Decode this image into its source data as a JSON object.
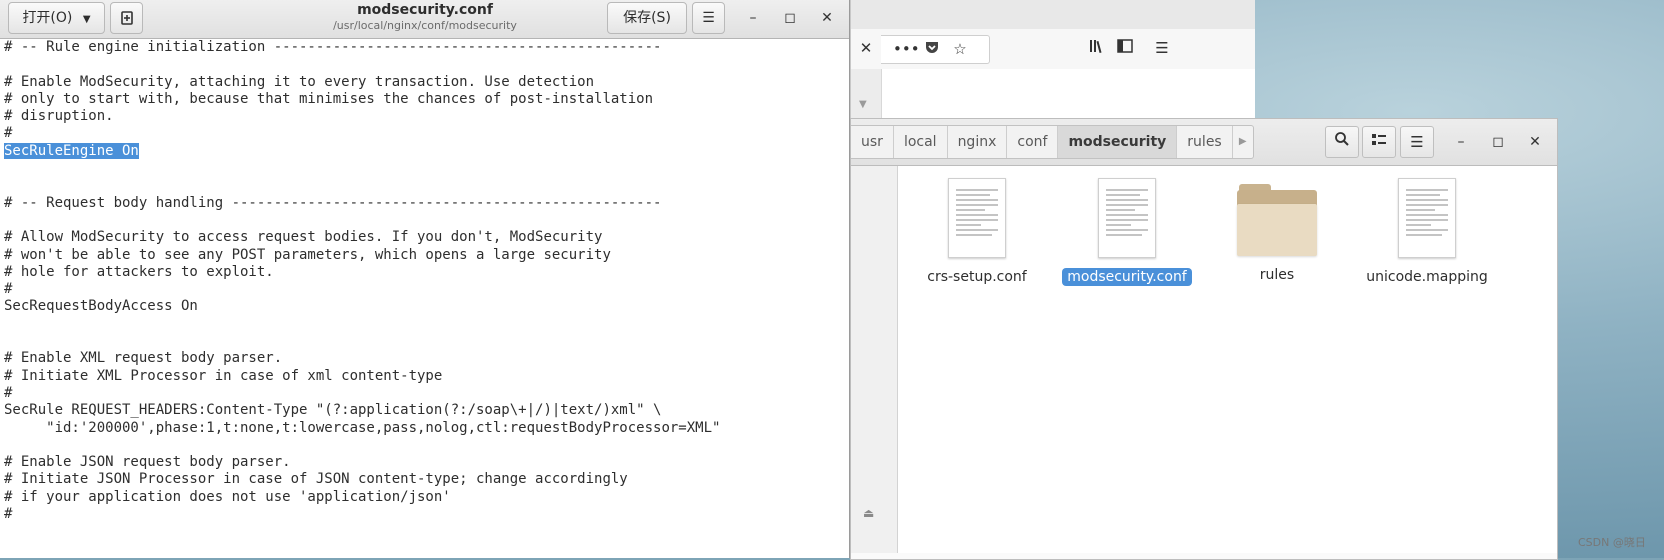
{
  "gedit": {
    "open_label": "打开(O)",
    "save_label": "保存(S)",
    "title": "modsecurity.conf",
    "subtitle": "/usr/local/nginx/conf/modsecurity",
    "lines": [
      "# -- Rule engine initialization ----------------------------------------------",
      "",
      "# Enable ModSecurity, attaching it to every transaction. Use detection",
      "# only to start with, because that minimises the chances of post-installation",
      "# disruption.",
      "#",
      "SecRuleEngine On",
      "",
      "",
      "# -- Request body handling ---------------------------------------------------",
      "",
      "# Allow ModSecurity to access request bodies. If you don't, ModSecurity",
      "# won't be able to see any POST parameters, which opens a large security",
      "# hole for attackers to exploit.",
      "#",
      "SecRequestBodyAccess On",
      "",
      "",
      "# Enable XML request body parser.",
      "# Initiate XML Processor in case of xml content-type",
      "#",
      "SecRule REQUEST_HEADERS:Content-Type \"(?:application(?:/soap\\+|/)|text/)xml\" \\",
      "     \"id:'200000',phase:1,t:none,t:lowercase,pass,nolog,ctl:requestBodyProcessor=XML\"",
      "",
      "# Enable JSON request body parser.",
      "# Initiate JSON Processor in case of JSON content-type; change accordingly",
      "# if your application does not use 'application/json'",
      "#"
    ],
    "selected_text": "SecRuleEngine On"
  },
  "file_manager": {
    "breadcrumbs": [
      "usr",
      "local",
      "nginx",
      "conf",
      "modsecurity",
      "rules"
    ],
    "active_crumb": "modsecurity",
    "files": [
      {
        "name": "crs-setup.conf",
        "icon": "text-file-icon"
      },
      {
        "name": "modsecurity.conf",
        "icon": "text-file-icon",
        "selected": true
      },
      {
        "name": "rules",
        "icon": "folder-icon"
      },
      {
        "name": "unicode.mapping",
        "icon": "text-file-icon"
      }
    ]
  },
  "browser": {
    "icons": [
      "close-icon",
      "more-icon",
      "pocket-icon",
      "bookmark-star-icon",
      "library-icon",
      "sidebar-icon",
      "menu-icon"
    ]
  },
  "watermark": "CSDN @晓日"
}
